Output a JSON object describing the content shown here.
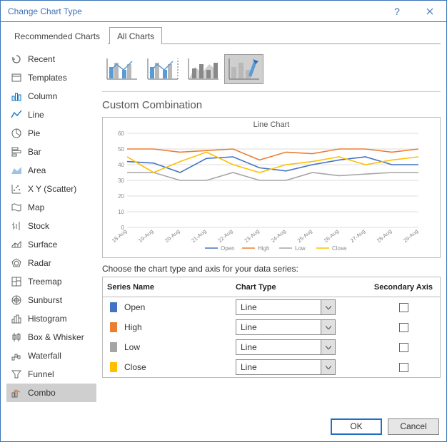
{
  "window": {
    "title": "Change Chart Type"
  },
  "tabs": {
    "recommended": "Recommended Charts",
    "all": "All Charts"
  },
  "sidebar": {
    "items": [
      {
        "label": "Recent"
      },
      {
        "label": "Templates"
      },
      {
        "label": "Column"
      },
      {
        "label": "Line"
      },
      {
        "label": "Pie"
      },
      {
        "label": "Bar"
      },
      {
        "label": "Area"
      },
      {
        "label": "X Y (Scatter)"
      },
      {
        "label": "Map"
      },
      {
        "label": "Stock"
      },
      {
        "label": "Surface"
      },
      {
        "label": "Radar"
      },
      {
        "label": "Treemap"
      },
      {
        "label": "Sunburst"
      },
      {
        "label": "Histogram"
      },
      {
        "label": "Box & Whisker"
      },
      {
        "label": "Waterfall"
      },
      {
        "label": "Funnel"
      },
      {
        "label": "Combo"
      }
    ]
  },
  "subtitle": "Custom Combination",
  "preview_title": "Line Chart",
  "instruction": "Choose the chart type and axis for your data series:",
  "grid": {
    "col_series": "Series Name",
    "col_type": "Chart Type",
    "col_secondary": "Secondary Axis",
    "rows": [
      {
        "name": "Open",
        "type": "Line",
        "color": "#4472c4"
      },
      {
        "name": "High",
        "type": "Line",
        "color": "#ed7d31"
      },
      {
        "name": "Low",
        "type": "Line",
        "color": "#a5a5a5"
      },
      {
        "name": "Close",
        "type": "Line",
        "color": "#ffc000"
      }
    ]
  },
  "buttons": {
    "ok": "OK",
    "cancel": "Cancel"
  },
  "chart_data": {
    "type": "line",
    "title": "Line Chart",
    "xlabel": "",
    "ylabel": "",
    "ylim": [
      0,
      60
    ],
    "yticks": [
      0,
      10,
      20,
      30,
      40,
      50,
      60
    ],
    "categories": [
      "18-Aug",
      "19-Aug",
      "20-Aug",
      "21-Aug",
      "22-Aug",
      "23-Aug",
      "24-Aug",
      "25-Aug",
      "26-Aug",
      "27-Aug",
      "28-Aug",
      "29-Aug"
    ],
    "series": [
      {
        "name": "Open",
        "color": "#4472c4",
        "values": [
          42,
          41,
          35,
          44,
          45,
          38,
          36,
          40,
          43,
          45,
          40,
          40
        ]
      },
      {
        "name": "High",
        "color": "#ed7d31",
        "values": [
          50,
          50,
          48,
          49,
          50,
          43,
          48,
          47,
          50,
          50,
          48,
          50
        ]
      },
      {
        "name": "Low",
        "color": "#a5a5a5",
        "values": [
          35,
          35,
          30,
          30,
          35,
          30,
          30,
          35,
          33,
          34,
          35,
          35
        ]
      },
      {
        "name": "Close",
        "color": "#ffc000",
        "values": [
          45,
          35,
          42,
          48,
          40,
          35,
          40,
          42,
          45,
          40,
          43,
          45
        ]
      }
    ],
    "legend": [
      "Open",
      "High",
      "Low",
      "Close"
    ]
  }
}
